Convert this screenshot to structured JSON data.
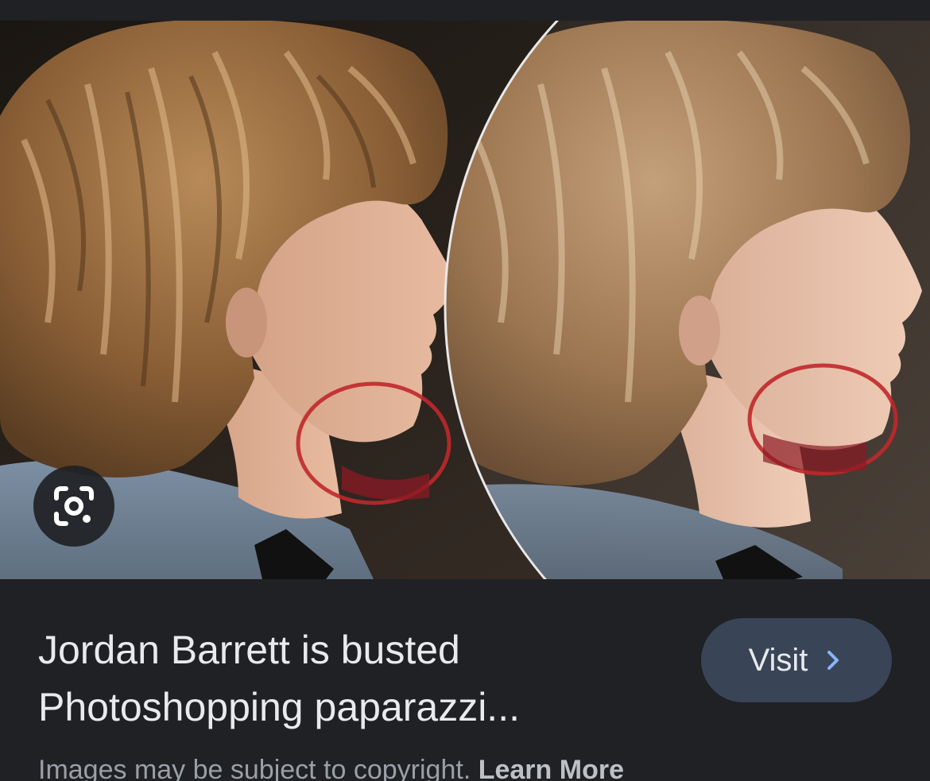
{
  "result": {
    "title": "Jordan Barrett is busted\nPhotoshopping paparazzi...",
    "visit_label": "Visit"
  },
  "footer": {
    "notice": "Images may be subject to copyright.",
    "learn_more": "Learn More"
  },
  "icons": {
    "lens": "google-lens-icon",
    "visit_arrow": "chevron-right-icon"
  },
  "colors": {
    "background": "#202124",
    "visit_button_bg": "#394457",
    "chevron": "#8ab4f8",
    "circle_annotation": "#c0282b"
  }
}
